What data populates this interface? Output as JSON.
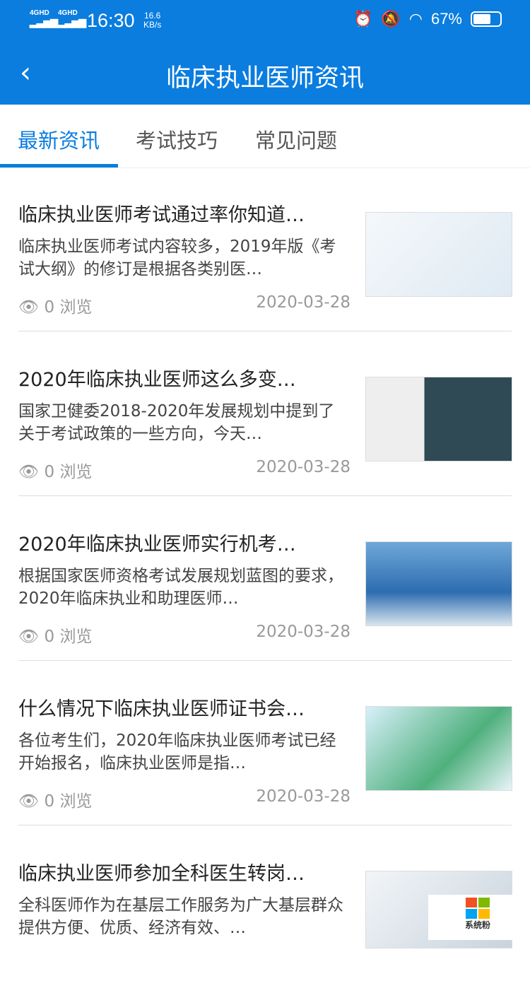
{
  "status": {
    "network1": "4GHD",
    "network2": "4GHD",
    "time": "16:30",
    "speed_value": "16.6",
    "speed_unit": "KB/s",
    "battery": "67%",
    "battery_level": 0.67
  },
  "header": {
    "back_icon": "chevron-left-icon",
    "title": "临床执业医师资讯"
  },
  "tabs": [
    {
      "label": "最新资讯",
      "active": true
    },
    {
      "label": "考试技巧"
    },
    {
      "label": "常见问题"
    }
  ],
  "articles": [
    {
      "title": "临床执业医师考试通过率你知道…",
      "desc": "临床执业医师考试内容较多，2019年版《考试大纲》的修订是根据各类别医…",
      "views": "0 浏览",
      "date": "2020-03-28",
      "image": "laboratory-illustration"
    },
    {
      "title": "2020年临床执业医师这么多变…",
      "desc": "国家卫健委2018-2020年发展规划中提到了关于考试政策的一些方向，今天…",
      "views": "0 浏览",
      "date": "2020-03-28",
      "image": "doctor-chalkboard-photo"
    },
    {
      "title": "2020年临床执业医师实行机考…",
      "desc": "根据国家医师资格考试发展规划蓝图的要求，2020年临床执业和助理医师…",
      "views": "0 浏览",
      "date": "2020-03-28",
      "image": "exam-book-photo"
    },
    {
      "title": "什么情况下临床执业医师证书会…",
      "desc": "各位考生们，2020年临床执业医师考试已经开始报名，临床执业医师是指…",
      "views": "0 浏览",
      "date": "2020-03-28",
      "image": "hospital-bed-illustration"
    },
    {
      "title": "临床执业医师参加全科医生转岗…",
      "desc": "全科医师作为在基层工作服务为广大基层群众提供方便、优质、经济有效、…",
      "views": "",
      "date": "",
      "image": "doctor-photo"
    }
  ],
  "watermark": {
    "text": "系统粉",
    "url": "www.win7999.com"
  }
}
